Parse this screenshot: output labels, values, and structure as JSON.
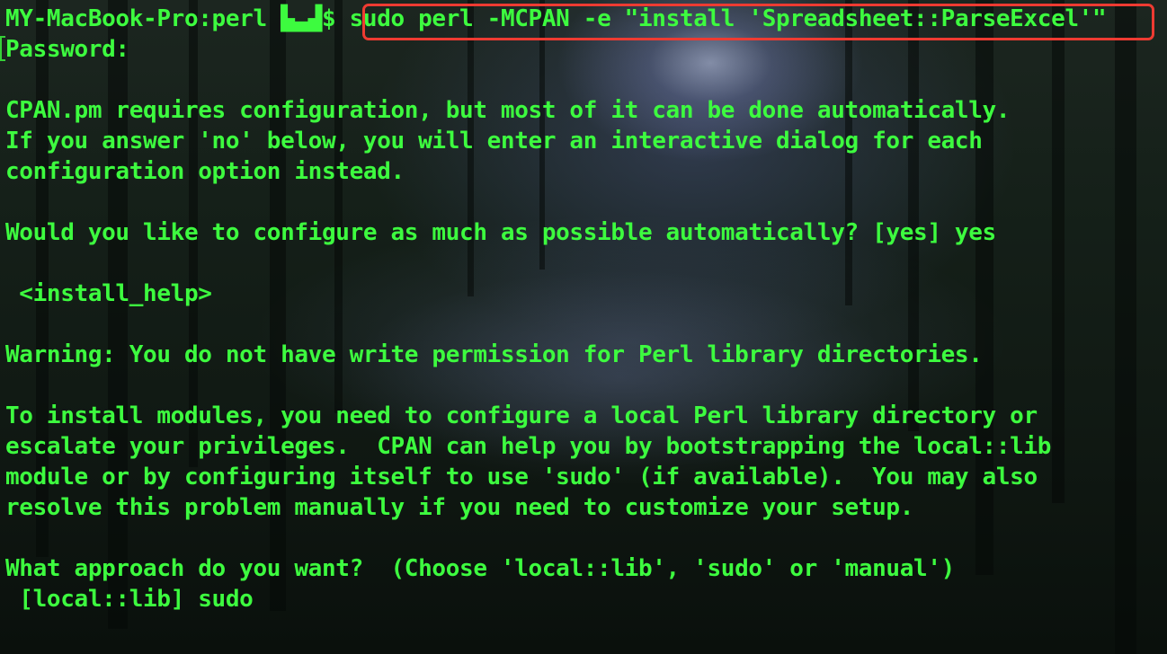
{
  "terminal": {
    "prompt": "MY-MacBook-Pro:perl ",
    "user_glyph": "▙▃▟",
    "prompt_suffix": "$ ",
    "command": "sudo perl -MCPAN -e \"install 'Spreadsheet::ParseExcel'\"",
    "lines": [
      "Password:",
      "",
      "CPAN.pm requires configuration, but most of it can be done automatically.",
      "If you answer 'no' below, you will enter an interactive dialog for each",
      "configuration option instead.",
      "",
      "Would you like to configure as much as possible automatically? [yes] yes",
      "",
      " <install_help>",
      "",
      "Warning: You do not have write permission for Perl library directories.",
      "",
      "To install modules, you need to configure a local Perl library directory or",
      "escalate your privileges.  CPAN can help you by bootstrapping the local::lib",
      "module or by configuring itself to use 'sudo' (if available).  You may also",
      "resolve this problem manually if you need to customize your setup.",
      "",
      "What approach do you want?  (Choose 'local::lib', 'sudo' or 'manual')",
      " [local::lib] sudo"
    ]
  },
  "colors": {
    "text": "#3dfb3f",
    "highlight_border": "#ee3b32"
  }
}
